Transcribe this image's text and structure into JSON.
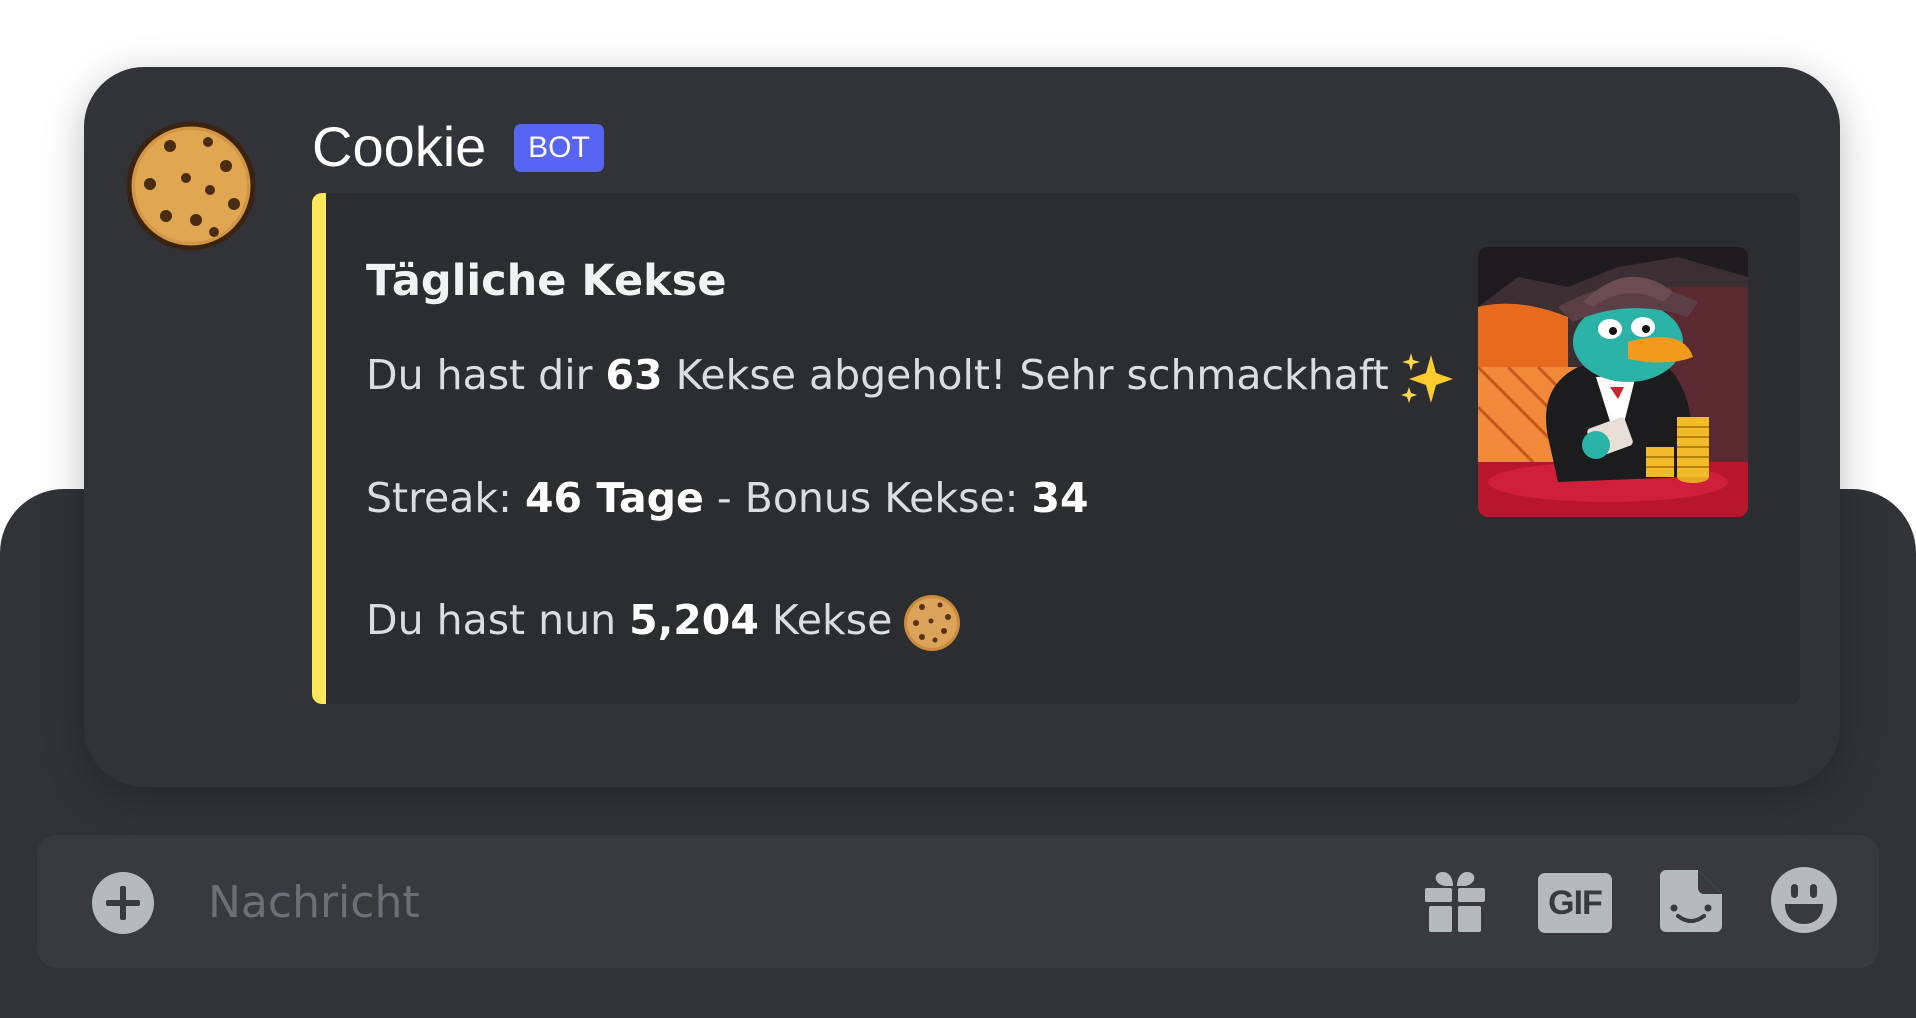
{
  "message": {
    "username": "Cookie",
    "badge": "BOT",
    "embed": {
      "accent_color": "#fee75c",
      "title": "Tägliche Kekse",
      "line1": {
        "prefix": "Du hast dir ",
        "amount": "63",
        "suffix": " Kekse abgeholt! Sehr schmackhaft",
        "emoji": "sparkles-icon"
      },
      "line2": {
        "prefix": "Streak: ",
        "streak": "46 Tage",
        "middle": " - Bonus Kekse: ",
        "bonus": "34"
      },
      "line3": {
        "prefix": "Du hast nun ",
        "total": "5,204",
        "suffix": " Kekse",
        "emoji": "cookie-icon"
      },
      "thumbnail": "platypus-agent-casino-image"
    }
  },
  "composer": {
    "placeholder": "Nachricht",
    "gif_label": "GIF",
    "icons": [
      "plus-circle-icon",
      "gift-icon",
      "gif-icon",
      "sticker-icon",
      "emoji-icon"
    ]
  },
  "colors": {
    "background": "#313338",
    "input": "#383a40",
    "embed": "#2b2d31",
    "blurple": "#5865f2"
  }
}
